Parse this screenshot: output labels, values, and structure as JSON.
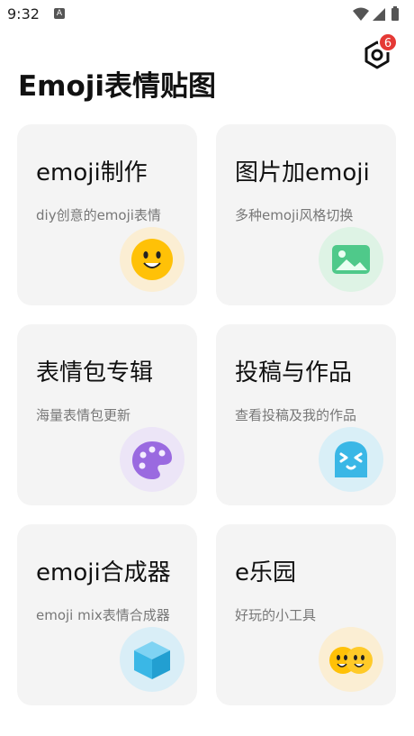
{
  "status_bar": {
    "time": "9:32",
    "app_letter": "A",
    "icons": [
      "wifi-icon",
      "signal-icon",
      "battery-icon"
    ]
  },
  "header": {
    "title": "Emoji表情贴图",
    "settings_icon": "hexagon-settings-icon",
    "badge_count": "6"
  },
  "cards": [
    {
      "title": "emoji制作",
      "subtitle": "diy创意的emoji表情",
      "icon": "smiley-face-icon",
      "icon_bg": "#fbeed3",
      "icon_color": "#ffc107"
    },
    {
      "title": "图片加emoji",
      "subtitle": "多种emoji风格切换",
      "icon": "image-icon",
      "icon_bg": "#def3e5",
      "icon_color": "#4fc98a"
    },
    {
      "title": "表情包专辑",
      "subtitle": "海量表情包更新",
      "icon": "palette-icon",
      "icon_bg": "#ece5f7",
      "icon_color": "#9a6ae0"
    },
    {
      "title": "投稿与作品",
      "subtitle": "查看投稿及我的作品",
      "icon": "ghost-face-icon",
      "icon_bg": "#d9eff7",
      "icon_color": "#3ab7e6"
    },
    {
      "title": "emoji合成器",
      "subtitle": "emoji mix表情合成器",
      "icon": "cube-icon",
      "icon_bg": "#d9eef7",
      "icon_color": "#3ab7e6"
    },
    {
      "title": "e乐园",
      "subtitle": "好玩的小工具",
      "icon": "double-smiley-icon",
      "icon_bg": "#fbeed3",
      "icon_color": "#ffc107"
    }
  ]
}
